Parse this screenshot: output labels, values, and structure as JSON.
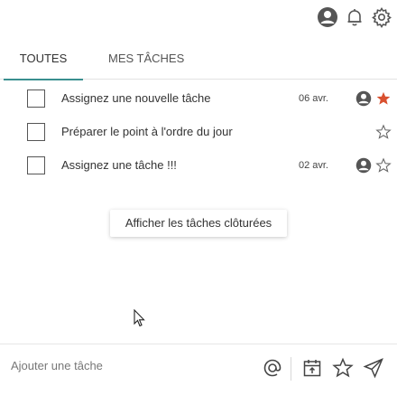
{
  "header": {
    "icons": [
      "user-avatar-icon",
      "bell-icon",
      "gear-icon"
    ]
  },
  "tabs": [
    {
      "label": "TOUTES",
      "active": true
    },
    {
      "label": "MES TÂCHES",
      "active": false
    }
  ],
  "tasks": [
    {
      "label": "Assignez une nouvelle tâche",
      "date": "06 avr.",
      "has_avatar": true,
      "starred": true
    },
    {
      "label": "Préparer le point à l'ordre du jour",
      "date": "",
      "has_avatar": false,
      "starred": false
    },
    {
      "label": "Assignez une tâche !!!",
      "date": "02 avr.",
      "has_avatar": true,
      "starred": false
    }
  ],
  "show_closed_label": "Afficher les tâches clôturées",
  "composer": {
    "placeholder": "Ajouter une tâche",
    "icons": [
      "at-icon",
      "calendar-icon",
      "star-icon",
      "send-icon"
    ]
  },
  "colors": {
    "accent": "#3a8f8f",
    "star_active": "#d9502f",
    "icon_grey": "#555555"
  }
}
